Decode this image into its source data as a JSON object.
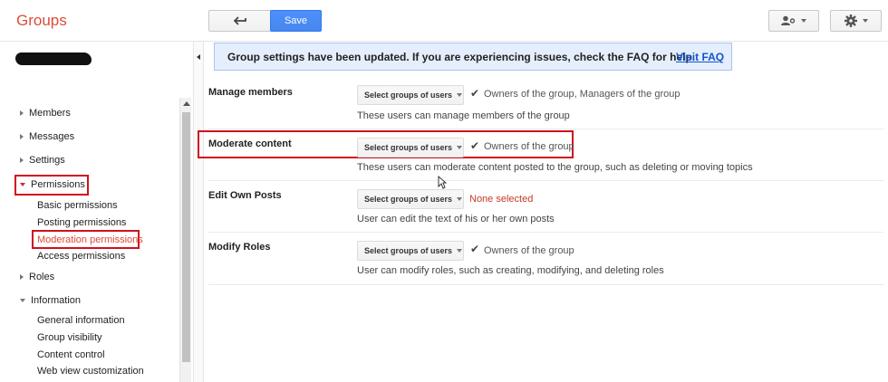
{
  "app": {
    "title": "Groups"
  },
  "toolbar": {
    "back_icon": "back-arrow-icon",
    "save_label": "Save",
    "share_icon": "person-settings-icon",
    "gear_icon": "gear-icon"
  },
  "banner": {
    "text": "Group settings have been updated. If you are experiencing issues, check the FAQ for help.",
    "link": "Visit FAQ"
  },
  "nav": {
    "items": [
      {
        "label": "Members"
      },
      {
        "label": "Messages"
      },
      {
        "label": "Settings"
      },
      {
        "label": "Permissions"
      },
      {
        "label": "Roles"
      },
      {
        "label": "Information"
      }
    ],
    "permissions_sub": [
      {
        "label": "Basic permissions"
      },
      {
        "label": "Posting permissions"
      },
      {
        "label": "Moderation permissions"
      },
      {
        "label": "Access permissions"
      }
    ],
    "information_sub": [
      {
        "label": "General information"
      },
      {
        "label": "Group visibility"
      },
      {
        "label": "Content control"
      },
      {
        "label": "Web view customization"
      }
    ]
  },
  "settings": [
    {
      "label": "Manage members",
      "select": "Select groups of users",
      "selected": "Owners of the group, Managers of the group",
      "description": "These users can manage members of the group"
    },
    {
      "label": "Moderate content",
      "select": "Select groups of users",
      "selected": "Owners of the group",
      "description": "These users can moderate content posted to the group, such as deleting or moving topics"
    },
    {
      "label": "Edit Own Posts",
      "select": "Select groups of users",
      "selected": "None selected",
      "description": "User can edit the text of his or her own posts"
    },
    {
      "label": "Modify Roles",
      "select": "Select groups of users",
      "selected": "Owners of the group",
      "description": "User can modify roles, such as creating, modifying, and deleting roles"
    }
  ],
  "colors": {
    "accent_red": "#dd4b39",
    "highlight_box": "#d0101d",
    "save_blue": "#4d90fe",
    "banner_bg": "#e5eefc"
  }
}
